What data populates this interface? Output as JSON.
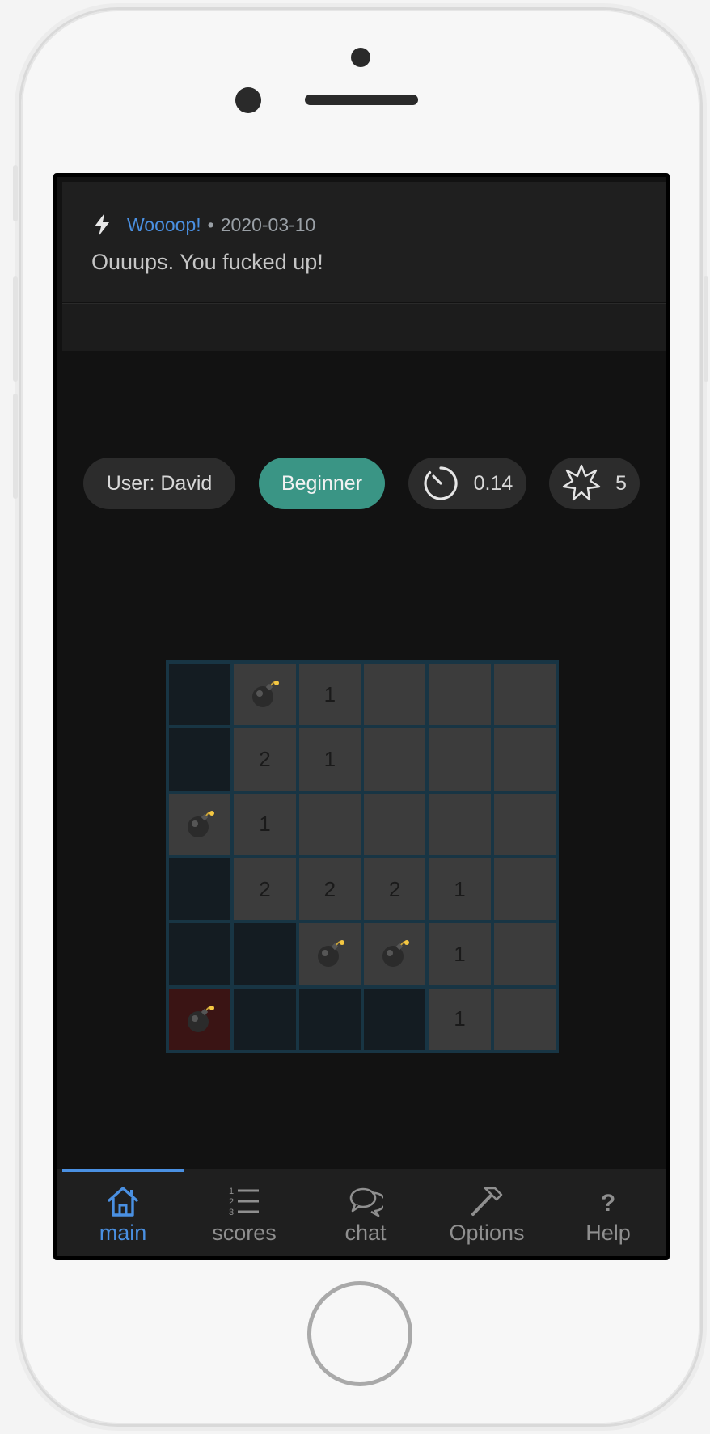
{
  "notification": {
    "source": "Woooop!",
    "separator": "•",
    "date": "2020-03-10",
    "message": "Ouuups. You fucked up!"
  },
  "status": {
    "user": "User: David",
    "level": "Beginner",
    "time": "0.14",
    "mines": "5"
  },
  "board": {
    "rows": 6,
    "cols": 6,
    "cells": [
      [
        "open",
        "mine",
        "1",
        "closed",
        "closed",
        "closed"
      ],
      [
        "open",
        "2",
        "1",
        "closed",
        "closed",
        "closed"
      ],
      [
        "mine",
        "1",
        "closed",
        "closed",
        "closed",
        "closed"
      ],
      [
        "open",
        "2",
        "2",
        "2",
        "1",
        "closed"
      ],
      [
        "open",
        "open",
        "mine",
        "mine",
        "1",
        "closed"
      ],
      [
        "exploded",
        "open",
        "open",
        "open",
        "1",
        "closed"
      ]
    ]
  },
  "tabs": [
    {
      "label": "main",
      "icon": "home-icon",
      "active": true
    },
    {
      "label": "scores",
      "icon": "list-numbered-icon",
      "active": false
    },
    {
      "label": "chat",
      "icon": "chat-bubbles-icon",
      "active": false
    },
    {
      "label": "Options",
      "icon": "hammer-icon",
      "active": false
    },
    {
      "label": "Help",
      "icon": "question-icon",
      "active": false
    }
  ],
  "colors": {
    "accent": "#4a90e2",
    "level_chip": "#3a9585",
    "board_grid": "#183544",
    "exploded_cell": "#3a1414"
  }
}
